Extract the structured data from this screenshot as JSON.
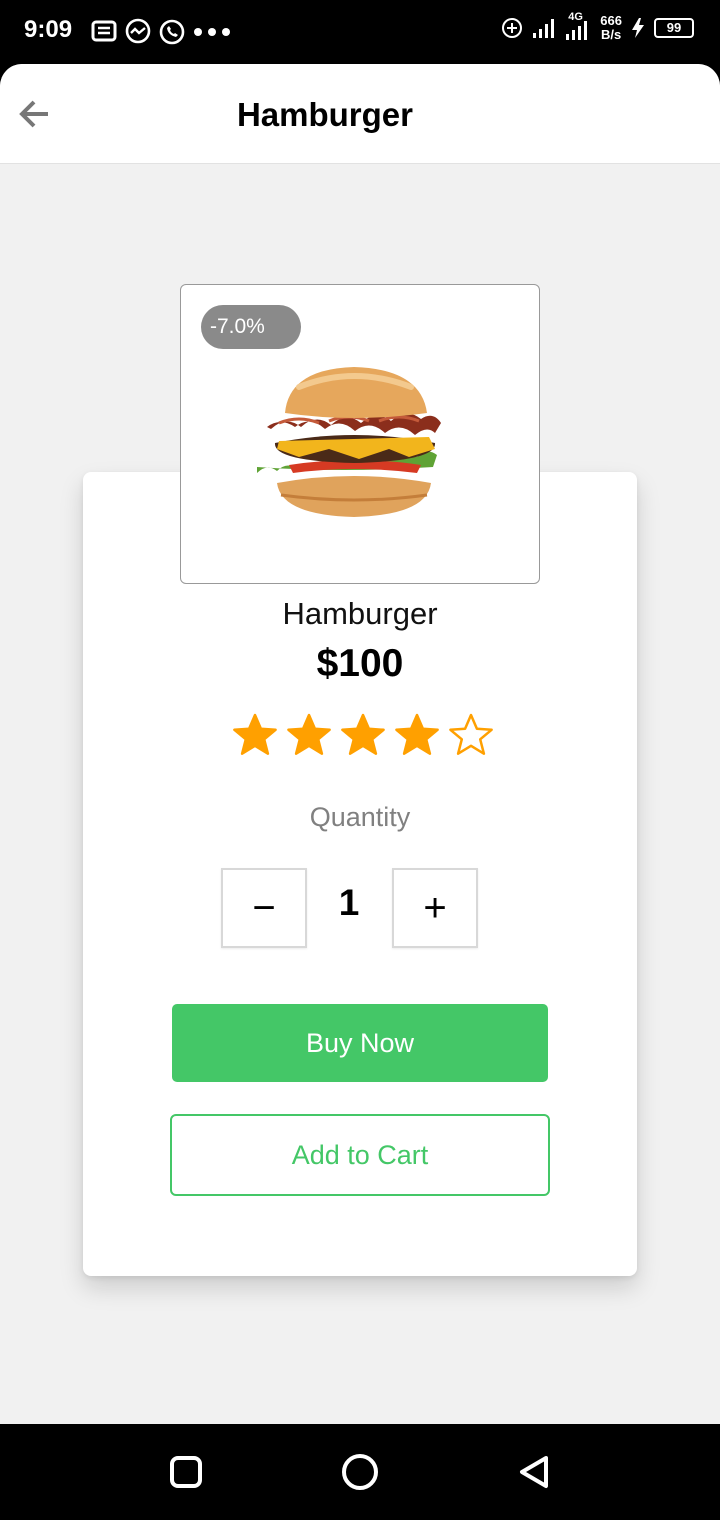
{
  "status_bar": {
    "time": "9:09",
    "network": "4G",
    "speed_value": "666",
    "speed_unit": "B/s",
    "battery": "99",
    "left_icons": [
      "notes-icon",
      "messenger-icon",
      "whatsapp-icon",
      "more-dots-icon"
    ],
    "right_icons": [
      "add-circle-icon",
      "signal-icon",
      "signal-4g-icon",
      "charging-icon",
      "battery-icon"
    ]
  },
  "app_bar": {
    "title": "Hamburger",
    "back_icon": "arrow-left-icon"
  },
  "product": {
    "discount": "-7.0%",
    "name": "Hamburger",
    "price": "$100",
    "rating": 4,
    "rating_max": 5,
    "image": "hamburger-image"
  },
  "quantity": {
    "label": "Quantity",
    "value": "1",
    "minus_symbol": "−",
    "plus_symbol": "+"
  },
  "actions": {
    "buy_label": "Buy Now",
    "cart_label": "Add to Cart"
  },
  "colors": {
    "accent_green": "#44c767",
    "star_gold": "#ffa000",
    "badge_gray": "#8a8a8a",
    "background": "#f1f1f1"
  },
  "nav_bar": {
    "buttons": [
      "recents-square-icon",
      "home-circle-icon",
      "back-triangle-icon"
    ]
  }
}
